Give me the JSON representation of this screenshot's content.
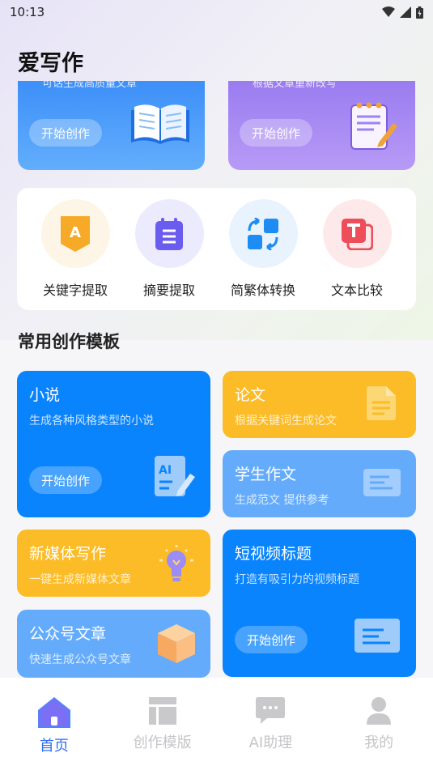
{
  "status_bar": {
    "time": "10:13"
  },
  "app_title": "爱写作",
  "hero_cards": [
    {
      "subtitle": "可话生成高质量文章",
      "button": "开始创作"
    },
    {
      "subtitle": "根据文章重新改写",
      "button": "开始创作"
    }
  ],
  "tools": [
    {
      "label": "关键字提取",
      "icon": "keyword-icon",
      "bg": "#fdf5e6"
    },
    {
      "label": "摘要提取",
      "icon": "summary-icon",
      "bg": "#eceafd"
    },
    {
      "label": "简繁体转换",
      "icon": "convert-icon",
      "bg": "#e8f3fd"
    },
    {
      "label": "文本比较",
      "icon": "compare-icon",
      "bg": "#fde9ea"
    }
  ],
  "section_title": "常用创作模板",
  "templates": {
    "novel": {
      "title": "小说",
      "desc": "生成各种风格类型的小说",
      "button": "开始创作"
    },
    "paper": {
      "title": "论文",
      "desc": "根据关键词生成论文"
    },
    "essay": {
      "title": "学生作文",
      "desc": "生成范文 提供参考"
    },
    "media": {
      "title": "新媒体写作",
      "desc": "一键生成新媒体文章"
    },
    "video": {
      "title": "短视频标题",
      "desc": "打造有吸引力的视频标题",
      "button": "开始创作"
    },
    "wechat": {
      "title": "公众号文章",
      "desc": "快速生成公众号文章"
    }
  },
  "bottom_nav": [
    {
      "label": "首页",
      "icon": "home-icon",
      "active": true
    },
    {
      "label": "创作模版",
      "icon": "template-icon",
      "active": false
    },
    {
      "label": "AI助理",
      "icon": "chat-icon",
      "active": false
    },
    {
      "label": "我的",
      "icon": "user-icon",
      "active": false
    }
  ],
  "colors": {
    "primary_blue": "#0a84fd",
    "yellow": "#fcbc27",
    "light_blue": "#64acfb",
    "nav_active": "#2f6df6",
    "nav_inactive": "#c5c5c8"
  }
}
